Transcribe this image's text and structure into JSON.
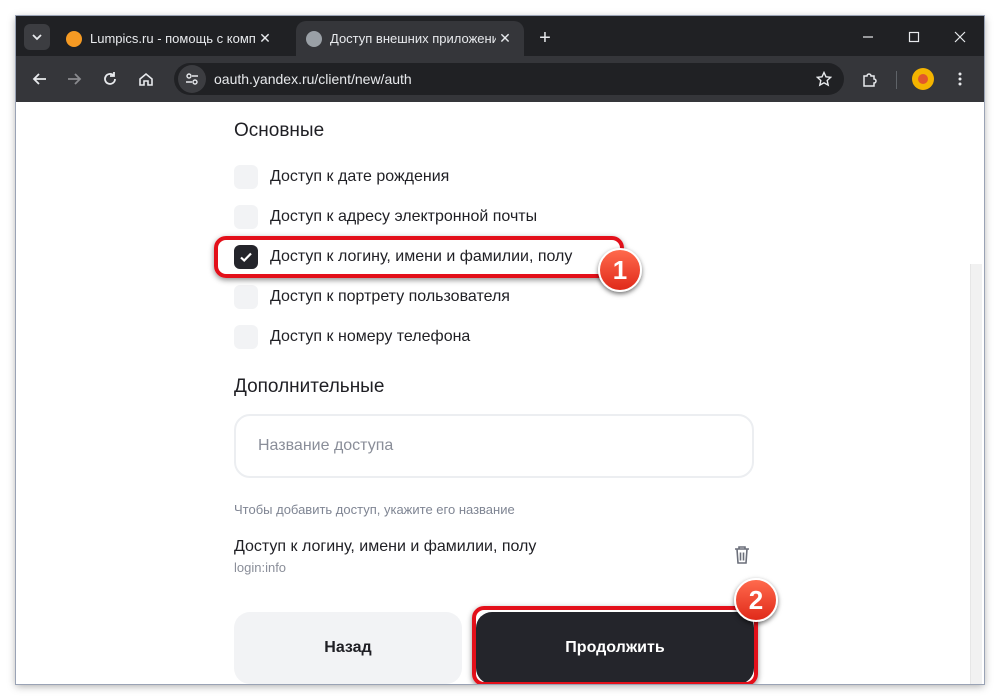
{
  "browser": {
    "tabs": [
      {
        "title": "Lumpics.ru - помощь с компьютером",
        "active": false,
        "favicon": "lumpics-orange-icon"
      },
      {
        "title": "Доступ внешних приложений",
        "active": true,
        "favicon": "globe-icon"
      }
    ],
    "address": "oauth.yandex.ru/client/new/auth"
  },
  "page": {
    "section_main": "Основные",
    "options": [
      {
        "label": "Доступ к дате рождения",
        "checked": false
      },
      {
        "label": "Доступ к адресу электронной почты",
        "checked": false
      },
      {
        "label": "Доступ к логину, имени и фамилии, полу",
        "checked": true
      },
      {
        "label": "Доступ к портрету пользователя",
        "checked": false
      },
      {
        "label": "Доступ к номеру телефона",
        "checked": false
      }
    ],
    "section_extra": "Дополнительные",
    "input_placeholder": "Название доступа",
    "input_hint": "Чтобы добавить доступ, укажите его название",
    "added_access": {
      "title": "Доступ к логину, имени и фамилии, полу",
      "scope": "login:info"
    },
    "back_label": "Назад",
    "continue_label": "Продолжить"
  },
  "annotations": {
    "badge1": "1",
    "badge2": "2",
    "highlight_color": "#e3101a"
  }
}
